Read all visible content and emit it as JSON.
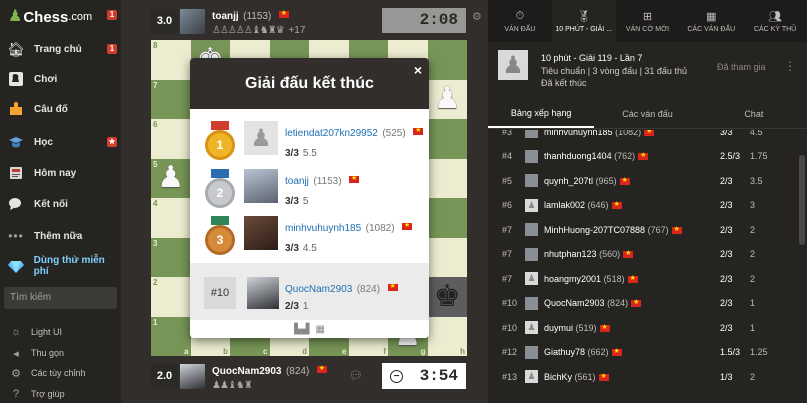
{
  "sidebar": {
    "logo_word": "Chess",
    "logo_com": ".com",
    "logo_badge": "1",
    "items": [
      {
        "label": "Trang chủ",
        "icon": "home-icon",
        "badge": "1"
      },
      {
        "label": "Chơi",
        "icon": "play-icon"
      },
      {
        "label": "Câu đố",
        "icon": "puzzle-icon"
      },
      {
        "label": "Học",
        "icon": "learn-icon",
        "badge": "★"
      },
      {
        "label": "Hôm nay",
        "icon": "news-icon"
      },
      {
        "label": "Kết nối",
        "icon": "social-icon"
      },
      {
        "label": "Thêm nữa",
        "icon": "more-icon"
      },
      {
        "label": "Dùng thử miễn phí",
        "icon": "diamond-icon"
      }
    ],
    "search_placeholder": "Tìm kiếm",
    "bottom": [
      {
        "label": "Light UI",
        "icon": "sun-icon"
      },
      {
        "label": "Thu gọn",
        "icon": "collapse-icon"
      },
      {
        "label": "Các tùy chỉnh",
        "icon": "settings-icon"
      },
      {
        "label": "Trợ giúp",
        "icon": "help-icon"
      }
    ]
  },
  "top_player": {
    "rating_box": "3.0",
    "name": "toanjj",
    "rating": "(1153)",
    "captured": "♙♙♙♙♙♝♞♜♛",
    "captured_extra": "+17",
    "clock": "2:08"
  },
  "bottom_player": {
    "rating_box": "2.0",
    "name": "QuocNam2903",
    "rating": "(824)",
    "captured": "♟♟♝♞♜",
    "clock": "3:54"
  },
  "board": {
    "ranks": [
      "8",
      "7",
      "6",
      "5",
      "4",
      "3",
      "2",
      "1"
    ],
    "files": [
      "a",
      "b",
      "c",
      "d",
      "e",
      "f",
      "g",
      "h"
    ],
    "light_color": "#ebecd0",
    "dark_color": "#779556"
  },
  "modal": {
    "title": "Giải đấu kết thúc",
    "close": "×",
    "podium": [
      {
        "place": "1",
        "name": "letiendat207kn29952",
        "rating": "(525)",
        "score": "3/3",
        "tiebreak": "5.5"
      },
      {
        "place": "2",
        "name": "toanjj",
        "rating": "(1153)",
        "score": "3/3",
        "tiebreak": "5"
      },
      {
        "place": "3",
        "name": "minhvuhuynh185",
        "rating": "(1082)",
        "score": "3/3",
        "tiebreak": "4.5"
      }
    ],
    "me": {
      "rank": "#10",
      "name": "QuocNam2903",
      "rating": "(824)",
      "score": "2/3",
      "tiebreak": "1"
    }
  },
  "right_nav": [
    {
      "label": "VÁN ĐẤU",
      "icon": "stopwatch-icon"
    },
    {
      "label": "10 PHÚT - GIẢI ...",
      "icon": "medal-icon"
    },
    {
      "label": "VÁN CỜ MỚI",
      "icon": "plus-icon"
    },
    {
      "label": "CÁC VÁN ĐẤU",
      "icon": "board-icon"
    },
    {
      "label": "CÁC KỲ THỦ",
      "icon": "players-icon"
    }
  ],
  "tournament": {
    "title": "10 phút - Giải 119 - Lần 7",
    "subtitle": "Tiêu chuẩn | 3 vòng đấu | 31 đấu thủ",
    "status": "Đã kết thúc",
    "joined": "Đã tham gia",
    "more": "⋮"
  },
  "subtabs": [
    "Bảng xếp hạng",
    "Các ván đấu",
    "Chat"
  ],
  "standings": [
    {
      "rank": "#3",
      "name": "minhvuhuynh185",
      "rating": "(1082)",
      "score": "3/3",
      "tb": "4.5"
    },
    {
      "rank": "#4",
      "name": "thanhduong1404",
      "rating": "(762)",
      "score": "2.5/3",
      "tb": "1.75"
    },
    {
      "rank": "#5",
      "name": "quynh_207tl",
      "rating": "(965)",
      "score": "2/3",
      "tb": "3.5"
    },
    {
      "rank": "#6",
      "name": "lamlak002",
      "rating": "(646)",
      "score": "2/3",
      "tb": "3"
    },
    {
      "rank": "#7",
      "name": "MinhHuong-207TC07888",
      "rating": "(767)",
      "score": "2/3",
      "tb": "2"
    },
    {
      "rank": "#7",
      "name": "nhutphan123",
      "rating": "(560)",
      "score": "2/3",
      "tb": "2"
    },
    {
      "rank": "#7",
      "name": "hoangmy2001",
      "rating": "(518)",
      "score": "2/3",
      "tb": "2"
    },
    {
      "rank": "#10",
      "name": "QuocNam2903",
      "rating": "(824)",
      "score": "2/3",
      "tb": "1"
    },
    {
      "rank": "#10",
      "name": "duymui",
      "rating": "(519)",
      "score": "2/3",
      "tb": "1"
    },
    {
      "rank": "#12",
      "name": "Giathuy78",
      "rating": "(662)",
      "score": "1.5/3",
      "tb": "1.25"
    },
    {
      "rank": "#13",
      "name": "BichKy",
      "rating": "(561)",
      "score": "1/3",
      "tb": "2"
    }
  ]
}
